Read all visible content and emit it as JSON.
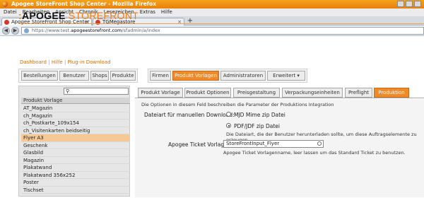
{
  "window": {
    "title": "Apogee StoreFront Shop Center - Mozilla Firefox"
  },
  "menubar": [
    "Datei",
    "Bearbeiten",
    "Ansicht",
    "Chronik",
    "Lesezeichen",
    "Extras",
    "Hilfe"
  ],
  "browser_tabs": [
    {
      "label": "Apogee StoreFront Shop Center",
      "active": true
    },
    {
      "label": "TGMegastore",
      "active": false
    }
  ],
  "address": {
    "prefix": "https://www.test.",
    "domain": "apogeestorefront.com",
    "path": "/sfadmin/a/index"
  },
  "logo": {
    "colon": ":",
    "brand": "APOGEE",
    "product": "STOREFRONT"
  },
  "toplinks": [
    "Dashboard",
    "Hilfe",
    "Plug-in Download"
  ],
  "toplinks_sep": "|",
  "nav_group1": [
    "Bestellungen",
    "Benutzer",
    "Shops",
    "Produkte"
  ],
  "nav_group2": [
    "Firmen",
    "Produkt Vorlagen",
    "Administratoren",
    "Erweitert ▾"
  ],
  "nav_active": "Produkt Vorlagen",
  "list": {
    "header": "Produkt Vorlage",
    "items": [
      "AT_Magazin",
      "ch_Magazin",
      "ch_Postkarte_109x154",
      "ch_Visitenkarten beidseitig",
      "Flyer A3",
      "Geschenk",
      "Glasbild",
      "Magazin",
      "Plakatwand",
      "Plakatwand 356x252",
      "Poster",
      "Tischset"
    ],
    "selected": "Flyer A3"
  },
  "content_tabs": [
    "Produkt Vorlage",
    "Produkt Optionen",
    "Preisgestaltung",
    "Verpackungseinheiten",
    "Preflight",
    "Produktion"
  ],
  "content_tab_active": "Produktion",
  "production": {
    "intro": "Die Optionen in diesem Feld beschreiben die Parameter der Produktions Integration",
    "download_label": "Dateiart für manuellen Download:",
    "option1": "MJD Mime zip Datei",
    "option2": "PDF/JDF zip Datei",
    "option2_help": "Die Dateiart, die der Benutzer herunterladen sollte, um diese Auftragselemente zu erzeugen.",
    "ticket_label": "Apogee Ticket Vorlage:",
    "ticket_value": "StoreFrontInput_Flyer",
    "ticket_help": "Apogee Ticket Vorlagenname, leer lassen um das Standard Ticket zu benutzen."
  }
}
